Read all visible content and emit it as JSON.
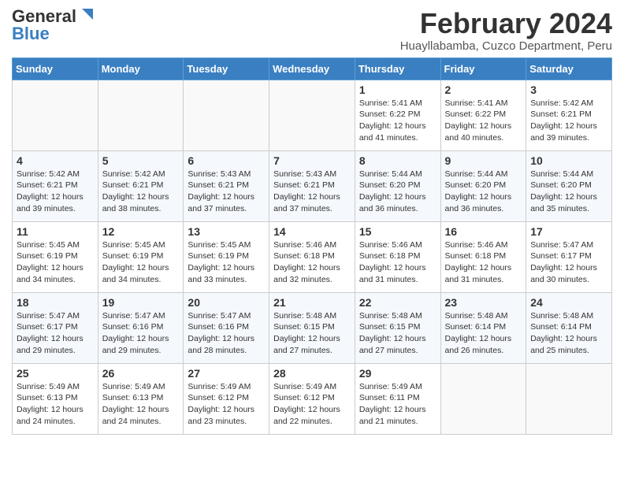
{
  "header": {
    "logo_general": "General",
    "logo_blue": "Blue",
    "month_year": "February 2024",
    "location": "Huayllabamba, Cuzco Department, Peru"
  },
  "columns": [
    "Sunday",
    "Monday",
    "Tuesday",
    "Wednesday",
    "Thursday",
    "Friday",
    "Saturday"
  ],
  "weeks": [
    [
      {
        "day": "",
        "info": ""
      },
      {
        "day": "",
        "info": ""
      },
      {
        "day": "",
        "info": ""
      },
      {
        "day": "",
        "info": ""
      },
      {
        "day": "1",
        "info": "Sunrise: 5:41 AM\nSunset: 6:22 PM\nDaylight: 12 hours and 41 minutes."
      },
      {
        "day": "2",
        "info": "Sunrise: 5:41 AM\nSunset: 6:22 PM\nDaylight: 12 hours and 40 minutes."
      },
      {
        "day": "3",
        "info": "Sunrise: 5:42 AM\nSunset: 6:21 PM\nDaylight: 12 hours and 39 minutes."
      }
    ],
    [
      {
        "day": "4",
        "info": "Sunrise: 5:42 AM\nSunset: 6:21 PM\nDaylight: 12 hours and 39 minutes."
      },
      {
        "day": "5",
        "info": "Sunrise: 5:42 AM\nSunset: 6:21 PM\nDaylight: 12 hours and 38 minutes."
      },
      {
        "day": "6",
        "info": "Sunrise: 5:43 AM\nSunset: 6:21 PM\nDaylight: 12 hours and 37 minutes."
      },
      {
        "day": "7",
        "info": "Sunrise: 5:43 AM\nSunset: 6:21 PM\nDaylight: 12 hours and 37 minutes."
      },
      {
        "day": "8",
        "info": "Sunrise: 5:44 AM\nSunset: 6:20 PM\nDaylight: 12 hours and 36 minutes."
      },
      {
        "day": "9",
        "info": "Sunrise: 5:44 AM\nSunset: 6:20 PM\nDaylight: 12 hours and 36 minutes."
      },
      {
        "day": "10",
        "info": "Sunrise: 5:44 AM\nSunset: 6:20 PM\nDaylight: 12 hours and 35 minutes."
      }
    ],
    [
      {
        "day": "11",
        "info": "Sunrise: 5:45 AM\nSunset: 6:19 PM\nDaylight: 12 hours and 34 minutes."
      },
      {
        "day": "12",
        "info": "Sunrise: 5:45 AM\nSunset: 6:19 PM\nDaylight: 12 hours and 34 minutes."
      },
      {
        "day": "13",
        "info": "Sunrise: 5:45 AM\nSunset: 6:19 PM\nDaylight: 12 hours and 33 minutes."
      },
      {
        "day": "14",
        "info": "Sunrise: 5:46 AM\nSunset: 6:18 PM\nDaylight: 12 hours and 32 minutes."
      },
      {
        "day": "15",
        "info": "Sunrise: 5:46 AM\nSunset: 6:18 PM\nDaylight: 12 hours and 31 minutes."
      },
      {
        "day": "16",
        "info": "Sunrise: 5:46 AM\nSunset: 6:18 PM\nDaylight: 12 hours and 31 minutes."
      },
      {
        "day": "17",
        "info": "Sunrise: 5:47 AM\nSunset: 6:17 PM\nDaylight: 12 hours and 30 minutes."
      }
    ],
    [
      {
        "day": "18",
        "info": "Sunrise: 5:47 AM\nSunset: 6:17 PM\nDaylight: 12 hours and 29 minutes."
      },
      {
        "day": "19",
        "info": "Sunrise: 5:47 AM\nSunset: 6:16 PM\nDaylight: 12 hours and 29 minutes."
      },
      {
        "day": "20",
        "info": "Sunrise: 5:47 AM\nSunset: 6:16 PM\nDaylight: 12 hours and 28 minutes."
      },
      {
        "day": "21",
        "info": "Sunrise: 5:48 AM\nSunset: 6:15 PM\nDaylight: 12 hours and 27 minutes."
      },
      {
        "day": "22",
        "info": "Sunrise: 5:48 AM\nSunset: 6:15 PM\nDaylight: 12 hours and 27 minutes."
      },
      {
        "day": "23",
        "info": "Sunrise: 5:48 AM\nSunset: 6:14 PM\nDaylight: 12 hours and 26 minutes."
      },
      {
        "day": "24",
        "info": "Sunrise: 5:48 AM\nSunset: 6:14 PM\nDaylight: 12 hours and 25 minutes."
      }
    ],
    [
      {
        "day": "25",
        "info": "Sunrise: 5:49 AM\nSunset: 6:13 PM\nDaylight: 12 hours and 24 minutes."
      },
      {
        "day": "26",
        "info": "Sunrise: 5:49 AM\nSunset: 6:13 PM\nDaylight: 12 hours and 24 minutes."
      },
      {
        "day": "27",
        "info": "Sunrise: 5:49 AM\nSunset: 6:12 PM\nDaylight: 12 hours and 23 minutes."
      },
      {
        "day": "28",
        "info": "Sunrise: 5:49 AM\nSunset: 6:12 PM\nDaylight: 12 hours and 22 minutes."
      },
      {
        "day": "29",
        "info": "Sunrise: 5:49 AM\nSunset: 6:11 PM\nDaylight: 12 hours and 21 minutes."
      },
      {
        "day": "",
        "info": ""
      },
      {
        "day": "",
        "info": ""
      }
    ]
  ]
}
